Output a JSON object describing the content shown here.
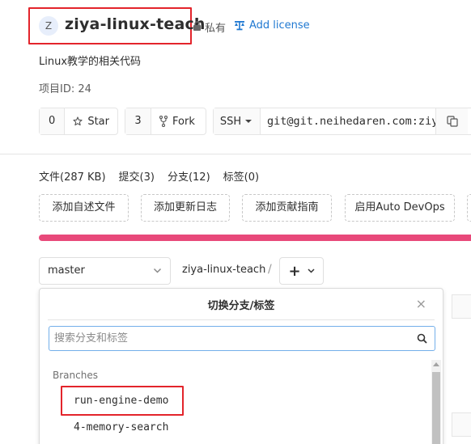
{
  "project": {
    "avatar_letter": "Z",
    "title": "ziya-linux-teach",
    "visibility": "私有",
    "license_link": "Add license",
    "description": "Linux教学的相关代码",
    "project_id_label": "项目ID: 24"
  },
  "actions": {
    "star_count": "0",
    "star_label": "Star",
    "fork_count": "3",
    "fork_label": "Fork",
    "ssh_label": "SSH",
    "clone_url": "git@git.neihedaren.com:ziya/ziya-linux-teach.git"
  },
  "stats": {
    "files": "文件(287 KB)",
    "commits": "提交(3)",
    "branches": "分支(12)",
    "tags": "标签(0)"
  },
  "quick_buttons": {
    "readme": "添加自述文件",
    "changelog": "添加更新日志",
    "contributing": "添加贡献指南",
    "autodevops": "启用Auto DevOps"
  },
  "repo_nav": {
    "branch": "master",
    "repo_crumb": "ziya-linux-teach",
    "separator": "/",
    "add_symbol": "+"
  },
  "dropdown": {
    "title": "切换分支/标签",
    "close_symbol": "×",
    "search_placeholder": "搜索分支和标签",
    "section_label": "Branches",
    "items": [
      "run-engine-demo",
      "4-memory-search"
    ]
  },
  "colors": {
    "accent_link": "#1f78d1",
    "highlight_box": "#e3242b",
    "progress_bar": "#e8497a"
  }
}
